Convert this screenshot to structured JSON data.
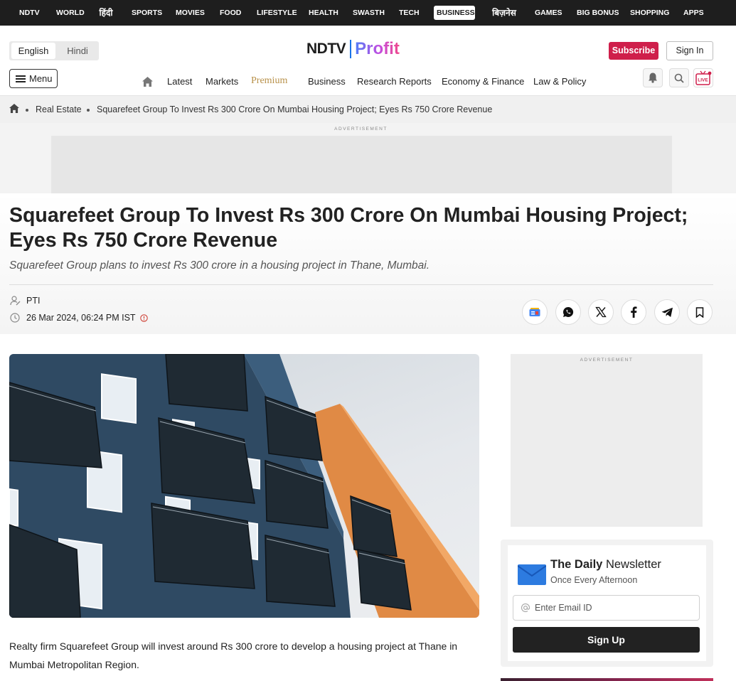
{
  "network_nav": [
    {
      "label": "NDTV"
    },
    {
      "label": "WORLD"
    },
    {
      "label": "हिंदी"
    },
    {
      "label": "SPORTS"
    },
    {
      "label": "MOVIES"
    },
    {
      "label": "FOOD"
    },
    {
      "label": "LIFESTYLE"
    },
    {
      "label": "HEALTH"
    },
    {
      "label": "SWASTH"
    },
    {
      "label": "TECH"
    },
    {
      "label": "BUSINESS",
      "active": true
    },
    {
      "label": "बिज़नेस"
    },
    {
      "label": "GAMES"
    },
    {
      "label": "BIG BONUS"
    },
    {
      "label": "SHOPPING"
    },
    {
      "label": "APPS"
    }
  ],
  "header": {
    "languages": [
      "English",
      "Hindi"
    ],
    "selected_language": "English",
    "logo_left": "NDTV",
    "logo_right": "Profit",
    "subscribe_label": "Subscribe",
    "signin_label": "Sign In",
    "menu_label": "Menu",
    "live_label": "LIVE"
  },
  "main_nav": [
    "Latest",
    "Markets",
    "Premium",
    "Business",
    "Research Reports",
    "Economy & Finance",
    "Law & Policy"
  ],
  "breadcrumb": {
    "section": "Real Estate",
    "current": "Squarefeet Group To Invest Rs 300 Crore On Mumbai Housing Project; Eyes Rs 750 Crore Revenue"
  },
  "ads": {
    "label": "ADVERTISEMENT"
  },
  "article": {
    "headline": "Squarefeet Group To Invest Rs 300 Crore On Mumbai Housing Project; Eyes Rs 750 Crore Revenue",
    "subheadline": "Squarefeet Group plans to invest Rs 300 crore in a housing project in Thane, Mumbai.",
    "author": "PTI",
    "published": "26 Mar 2024, 06:24 PM IST",
    "body_first_paragraph": "Realty firm Squarefeet Group will invest around Rs 300 crore to develop a housing project at Thane in Mumbai Metropolitan Region."
  },
  "share_buttons": [
    "google-news",
    "whatsapp",
    "x",
    "facebook",
    "telegram",
    "bookmark"
  ],
  "newsletter": {
    "title_bold": "The Daily",
    "title_rest": "Newsletter",
    "subtitle": "Once Every Afternoon",
    "email_placeholder": "Enter Email ID",
    "signup_label": "Sign Up"
  },
  "colors": {
    "brand_pink": "#cf1f4b",
    "premium_gold": "#b8914a",
    "topbar": "#1e1e1e"
  }
}
